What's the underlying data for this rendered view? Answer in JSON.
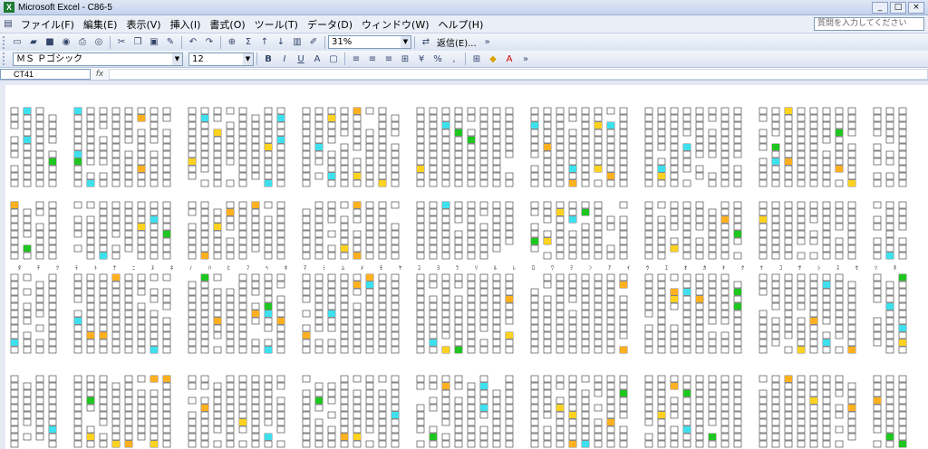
{
  "window": {
    "title": "Microsoft Excel - C86-5",
    "min": "_",
    "max": "□",
    "close": "×"
  },
  "menu": {
    "items": [
      "ファイル(F)",
      "編集(E)",
      "表示(V)",
      "挿入(I)",
      "書式(O)",
      "ツール(T)",
      "データ(D)",
      "ウィンドウ(W)",
      "ヘルプ(H)"
    ],
    "help_placeholder": "質問を入力してください"
  },
  "toolbar1": {
    "zoom": "31%",
    "reply": "返信(E)..."
  },
  "toolbar2": {
    "font": "ＭＳ Ｐゴシック",
    "size": "12"
  },
  "formula": {
    "cell": "CT41",
    "fx": "fx",
    "value": ""
  },
  "sheet": {
    "row_labels": [
      "ﾀ",
      "ﾁ",
      "ﾂ",
      "ﾃ",
      "ﾄ",
      "ﾅ",
      "ﾆ",
      "ﾇ",
      "ﾈ",
      "ﾉ",
      "ﾊ",
      "ﾋ",
      "ﾌ",
      "ﾍ",
      "ﾎ",
      "ﾏ",
      "ﾐ",
      "ﾑ",
      "ﾒ",
      "ﾓ",
      "ﾔ",
      "ﾕ",
      "ﾖ",
      "ﾗ",
      "ﾘ",
      "ﾙ",
      "ﾚ",
      "ﾛ",
      "ﾜ",
      "ｦ",
      "ﾝ",
      "ｱ",
      "ｲ",
      "ｳ",
      "ｴ",
      "ｵ",
      "ｶ",
      "ｷ",
      "ｸ",
      "ｹ",
      "ｺ",
      "ｻ",
      "ｼ",
      "ｽ",
      "ｾ",
      "ｿ",
      "ﾀ"
    ],
    "highlight_colors": {
      "yellow": "#ffd21f",
      "cyan": "#3ee0ee",
      "green": "#1fc61f",
      "orange": "#ffb020"
    }
  }
}
